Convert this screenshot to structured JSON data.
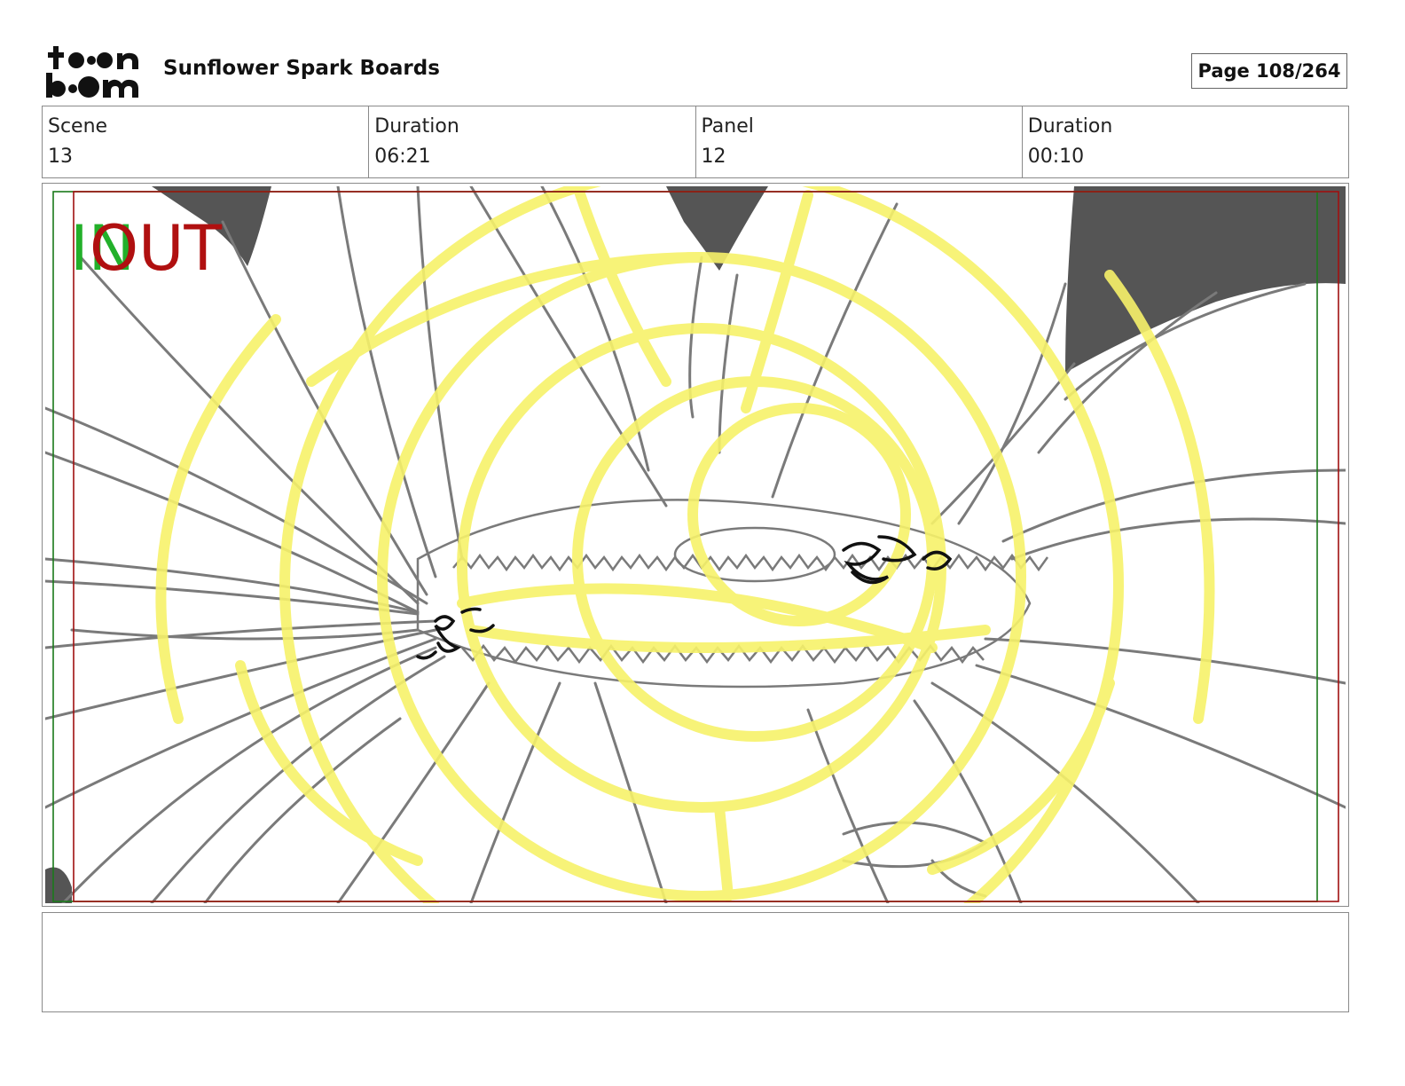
{
  "header": {
    "logo_text_top": "toon",
    "logo_text_bottom": "boom",
    "project_title": "Sunflower Spark Boards",
    "page_label": "Page 108/264"
  },
  "info": {
    "scene_label": "Scene",
    "scene_value": "13",
    "scene_duration_label": "Duration",
    "scene_duration_value": "06:21",
    "panel_label": "Panel",
    "panel_value": "12",
    "panel_duration_label": "Duration",
    "panel_duration_value": "00:10"
  },
  "panel": {
    "in_marker": "IN",
    "out_marker": "OUT",
    "in_color": "#22b02a",
    "out_color": "#b01010",
    "sketch_color": "#7a7a7a",
    "highlight_color": "#f7f26a",
    "ink_color": "#111111"
  },
  "notes": {
    "text": ""
  }
}
